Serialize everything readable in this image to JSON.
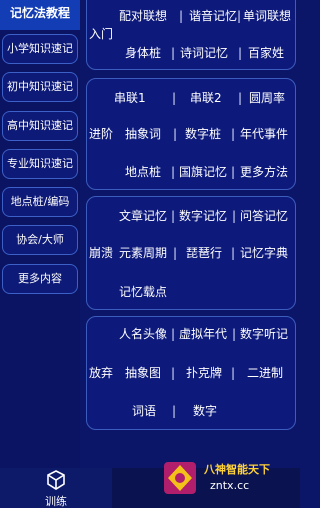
{
  "sidebar": {
    "header": "记忆法教程",
    "items": [
      {
        "label": "小学知识速记"
      },
      {
        "label": "初中知识速记"
      },
      {
        "label": "高中知识速记"
      },
      {
        "label": "专业知识速记"
      },
      {
        "label": "地点桩/编码"
      },
      {
        "label": "协会/大师"
      },
      {
        "label": "更多内容"
      }
    ]
  },
  "panel1": {
    "row1": [
      "配对联想",
      "谐音记忆",
      "单词联想"
    ],
    "row1_wrap": "入门",
    "row2": [
      "身体桩",
      "诗词记忆",
      "百家姓"
    ]
  },
  "panel2": {
    "row1": [
      "串联1",
      "串联2",
      "圆周率"
    ],
    "row2": [
      "进阶",
      "抽象词",
      "数字桩",
      "年代事件"
    ],
    "row3": [
      "地点桩",
      "国旗记忆",
      "更多方法"
    ]
  },
  "panel3": {
    "row1": [
      "文章记忆",
      "数字记忆",
      "问答记忆"
    ],
    "row2": [
      "崩溃",
      "元素周期",
      "琵琶行",
      "记忆字典"
    ],
    "row3": [
      "记忆载点"
    ]
  },
  "panel4": {
    "row1": [
      "人名头像",
      "虚拟年代",
      "数字听记"
    ],
    "row2": [
      "放弃",
      "抽象图",
      "扑克牌",
      "二进制"
    ],
    "row3": [
      "词语",
      "数字"
    ]
  },
  "separator": "|",
  "bottom_nav": {
    "train_label": "训练"
  },
  "watermark": {
    "line1": "八神智能天下",
    "line2": "zntx.cc"
  }
}
